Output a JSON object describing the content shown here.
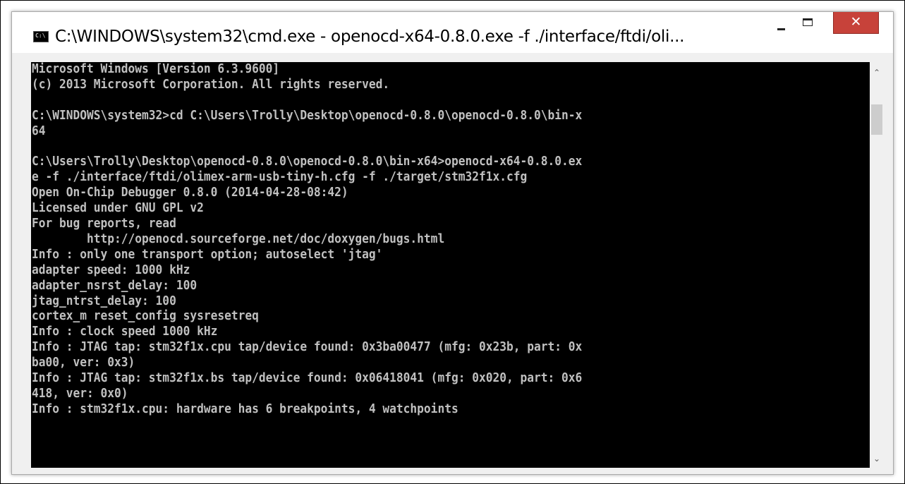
{
  "window": {
    "title": "C:\\WINDOWS\\system32\\cmd.exe - openocd-x64-0.8.0.exe  -f ./interface/ftdi/oli...",
    "icon_label": "C:\\",
    "minimize_glyph": "",
    "maximize_glyph": "",
    "close_glyph": "✕",
    "close_color": "#c7423a"
  },
  "console": {
    "background": "#000000",
    "foreground": "#c0c0c0",
    "lines": [
      "Microsoft Windows [Version 6.3.9600]",
      "(c) 2013 Microsoft Corporation. All rights reserved.",
      "",
      "C:\\WINDOWS\\system32>cd C:\\Users\\Trolly\\Desktop\\openocd-0.8.0\\openocd-0.8.0\\bin-x",
      "64",
      "",
      "C:\\Users\\Trolly\\Desktop\\openocd-0.8.0\\openocd-0.8.0\\bin-x64>openocd-x64-0.8.0.ex",
      "e -f ./interface/ftdi/olimex-arm-usb-tiny-h.cfg -f ./target/stm32f1x.cfg",
      "Open On-Chip Debugger 0.8.0 (2014-04-28-08:42)",
      "Licensed under GNU GPL v2",
      "For bug reports, read",
      "        http://openocd.sourceforge.net/doc/doxygen/bugs.html",
      "Info : only one transport option; autoselect 'jtag'",
      "adapter speed: 1000 kHz",
      "adapter_nsrst_delay: 100",
      "jtag_ntrst_delay: 100",
      "cortex_m reset_config sysresetreq",
      "Info : clock speed 1000 kHz",
      "Info : JTAG tap: stm32f1x.cpu tap/device found: 0x3ba00477 (mfg: 0x23b, part: 0x",
      "ba00, ver: 0x3)",
      "Info : JTAG tap: stm32f1x.bs tap/device found: 0x06418041 (mfg: 0x020, part: 0x6",
      "418, ver: 0x0)",
      "Info : stm32f1x.cpu: hardware has 6 breakpoints, 4 watchpoints"
    ]
  },
  "scrollbar": {
    "up_arrow": "⌃",
    "down_arrow": "⌄",
    "scroll_position": 0
  }
}
